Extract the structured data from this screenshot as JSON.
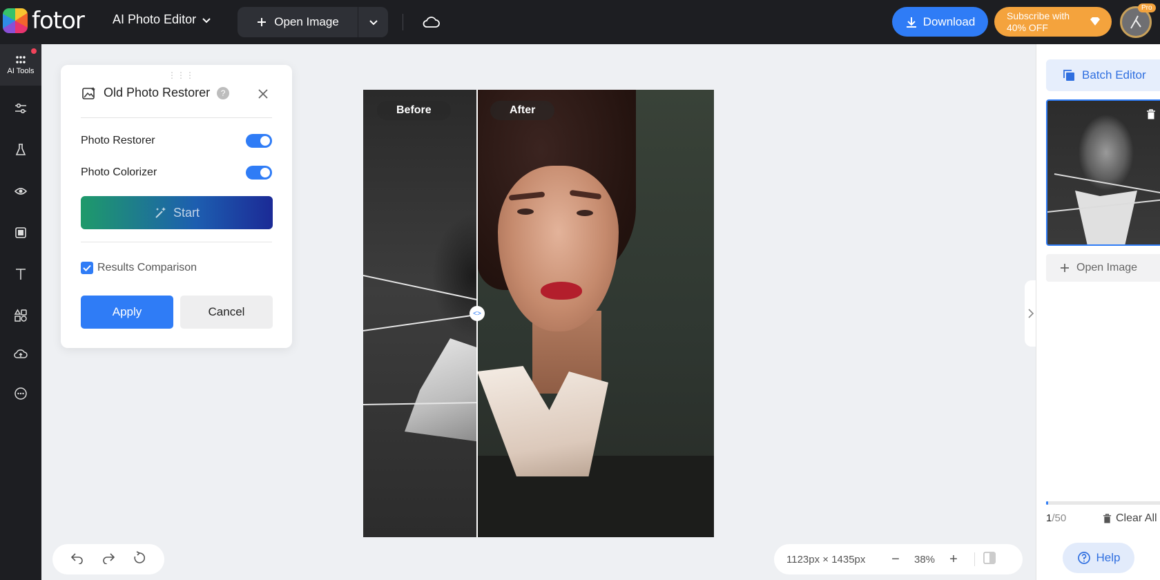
{
  "topbar": {
    "logo_text": "fotor",
    "app_menu_label": "AI Photo Editor",
    "open_image_label": "Open Image",
    "download_label": "Download",
    "subscribe_line1": "Subscribe with",
    "subscribe_line2": "40% OFF",
    "pro_badge": "Pro"
  },
  "rail": {
    "active_label": "AI Tools",
    "items": [
      "ai-tools",
      "adjust",
      "effects",
      "beauty",
      "frames",
      "text",
      "elements",
      "upload",
      "more"
    ]
  },
  "panel": {
    "title": "Old Photo Restorer",
    "help_symbol": "?",
    "options": [
      {
        "label": "Photo Restorer",
        "enabled": true
      },
      {
        "label": "Photo Colorizer",
        "enabled": true
      }
    ],
    "start_label": "Start",
    "comparison_label": "Results Comparison",
    "comparison_checked": true,
    "apply_label": "Apply",
    "cancel_label": "Cancel"
  },
  "canvas": {
    "before_label": "Before",
    "after_label": "After"
  },
  "zoom": {
    "image_size": "1123px × 1435px",
    "zoom_out": "−",
    "zoom_level": "38%",
    "zoom_in": "+"
  },
  "right_panel": {
    "batch_editor_label": "Batch Editor",
    "open_image_label": "Open Image",
    "count_current": "1",
    "count_total": "/50",
    "progress_fraction": 0.02,
    "clear_all_label": "Clear All",
    "help_label": "Help"
  },
  "colors": {
    "accent": "#2f7cf6",
    "topbar": "#1d1e22",
    "subscribe": "#f4a33d"
  }
}
